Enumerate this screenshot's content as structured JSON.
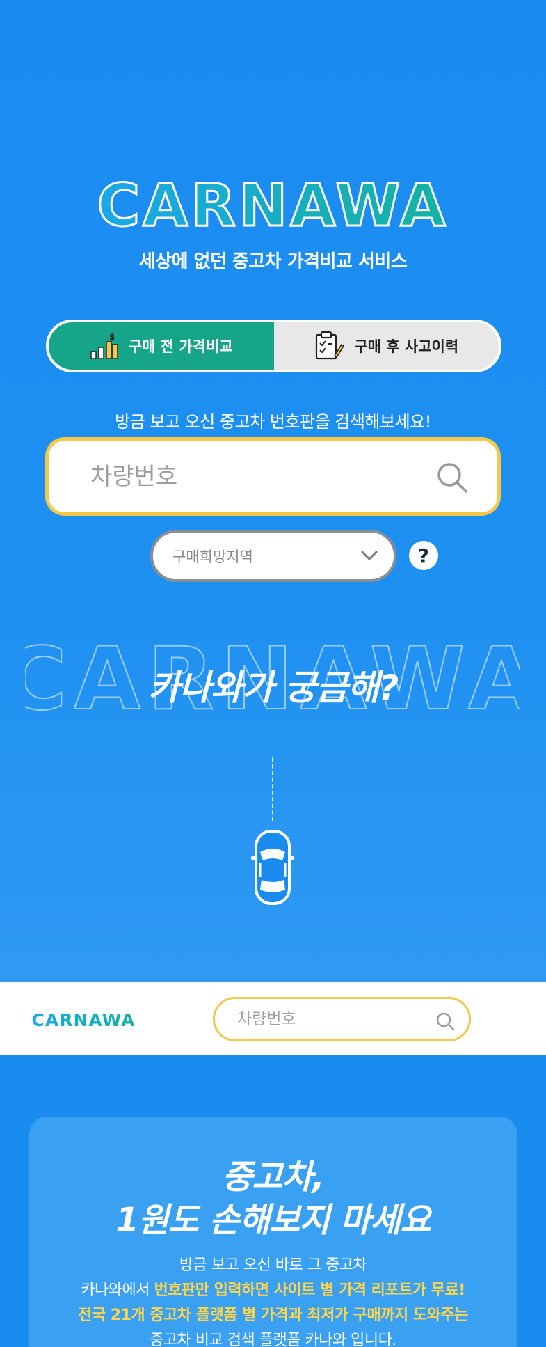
{
  "brand": {
    "logo_text": "CARNAWA",
    "tagline": "세상에 없던 중고차 가격비교 서비스"
  },
  "toggle": {
    "before_label": "구매 전 가격비교",
    "after_label": "구매 후 사고이력"
  },
  "search": {
    "hint": "방금 보고 오신 중고차 번호판을 검색해보세요!",
    "placeholder": "차량번호"
  },
  "region": {
    "placeholder": "구매희망지역",
    "help_label": "?"
  },
  "intro": {
    "heading": "카나와가 궁금해?"
  },
  "navbar": {
    "logo_text": "CARNAWA",
    "search_placeholder": "차량번호"
  },
  "card": {
    "title_line1": "중고차,",
    "title_line2": "1원도 손해보지 마세요",
    "line1": "방금 보고 오신 바로 그 중고차",
    "line2_prefix": "카나와에서 ",
    "line2_highlight": "번호판만 입력하면 사이트 별 가격 리포트가 무료!",
    "line3_highlight": "전국 21개 중고차 플랫폼 별 가격과 최저가 구매까지 도와주는",
    "line4": "중고차 비교 검색 플랫폼 카나와 입니다."
  },
  "colors": {
    "background": "#1a8cf0",
    "accent_green": "#17a58a",
    "highlight_yellow": "#f5c84a",
    "logo_blue": "#1aa8e8",
    "logo_teal": "#14b3a0"
  },
  "icons": {
    "chart": "bar-chart-dollar-icon",
    "clipboard": "clipboard-check-icon",
    "search": "search-icon",
    "chevron": "chevron-down-icon",
    "car": "car-top-view-icon"
  }
}
